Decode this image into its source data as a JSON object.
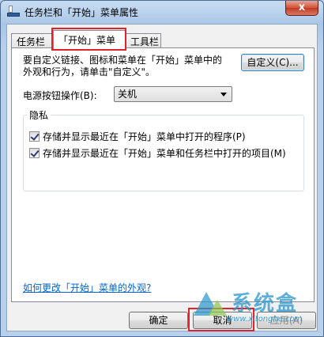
{
  "window": {
    "title": "任务栏和「开始」菜单属性",
    "close_label": "x"
  },
  "tabs": [
    {
      "label": "任务栏"
    },
    {
      "label": "「开始」菜单"
    },
    {
      "label": "工具栏"
    }
  ],
  "panel": {
    "description": "要自定义链接、图标和菜单在「开始」菜单中的\n外观和行为，请单击\"自定义\"。",
    "customize_label": "自定义(C)...",
    "power_label": "电源按钮操作(B):",
    "power_value": "关机",
    "privacy_label": "隐私",
    "check1_label": "存储并显示最近在「开始」菜单中打开的程序(P)",
    "check2_label": "存储并显示最近在「开始」菜单和任务栏中打开的项目(M)",
    "help_link": "如何更改「开始」菜单的外观?"
  },
  "footer": {
    "ok_label": "确定",
    "cancel_label": "取消",
    "apply_label": "应用(A)"
  },
  "watermark": {
    "text": "系统盒",
    "url": "www.xitonghe.com"
  }
}
